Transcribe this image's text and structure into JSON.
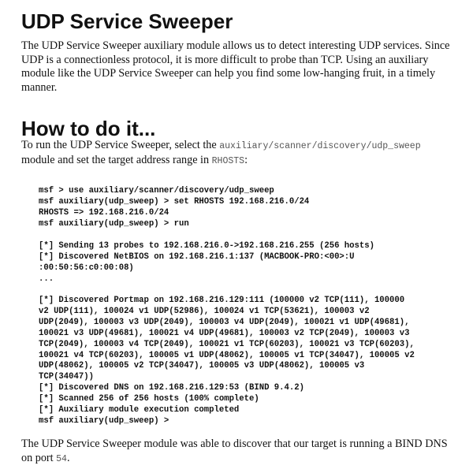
{
  "section1": {
    "title": "UDP Service Sweeper",
    "paragraph": "The UDP Service Sweeper auxiliary module allows us to detect interesting UDP services. Since UDP is a connectionless protocol, it is more difficult to probe than TCP. Using an auxiliary module like the UDP Service Sweeper can help you find some low-hanging fruit, in a timely manner."
  },
  "section2": {
    "title": "How to do it...",
    "intro_before": "To run the UDP Service Sweeper, select the ",
    "module_path": "auxiliary/scanner/discovery/udp_sweep",
    "intro_middle": " module and set the target address range in ",
    "rhosts_label": "RHOSTS",
    "intro_after": ":"
  },
  "code": {
    "block1": "msf > use auxiliary/scanner/discovery/udp_sweep\nmsf auxiliary(udp_sweep) > set RHOSTS 192.168.216.0/24\nRHOSTS => 192.168.216.0/24\nmsf auxiliary(udp_sweep) > run",
    "block2": "[*] Sending 13 probes to 192.168.216.0->192.168.216.255 (256 hosts)\n[*] Discovered NetBIOS on 192.168.216.1:137 (MACBOOK-PRO:<00>:U\n:00:50:56:c0:00:08)\n...",
    "block3": "[*] Discovered Portmap on 192.168.216.129:111 (100000 v2 TCP(111), 100000\nv2 UDP(111), 100024 v1 UDP(52986), 100024 v1 TCP(53621), 100003 v2\nUDP(2049), 100003 v3 UDP(2049), 100003 v4 UDP(2049), 100021 v1 UDP(49681),\n100021 v3 UDP(49681), 100021 v4 UDP(49681), 100003 v2 TCP(2049), 100003 v3\nTCP(2049), 100003 v4 TCP(2049), 100021 v1 TCP(60203), 100021 v3 TCP(60203),\n100021 v4 TCP(60203), 100005 v1 UDP(48062), 100005 v1 TCP(34047), 100005 v2\nUDP(48062), 100005 v2 TCP(34047), 100005 v3 UDP(48062), 100005 v3\nTCP(34047))\n[*] Discovered DNS on 192.168.216.129:53 (BIND 9.4.2)\n[*] Scanned 256 of 256 hosts (100% complete)\n[*] Auxiliary module execution completed\nmsf auxiliary(udp_sweep) >"
  },
  "conclusion": {
    "text_before": "The UDP Service Sweeper module was able to discover that our target is running a BIND DNS on port ",
    "port": "54",
    "text_after": "."
  }
}
